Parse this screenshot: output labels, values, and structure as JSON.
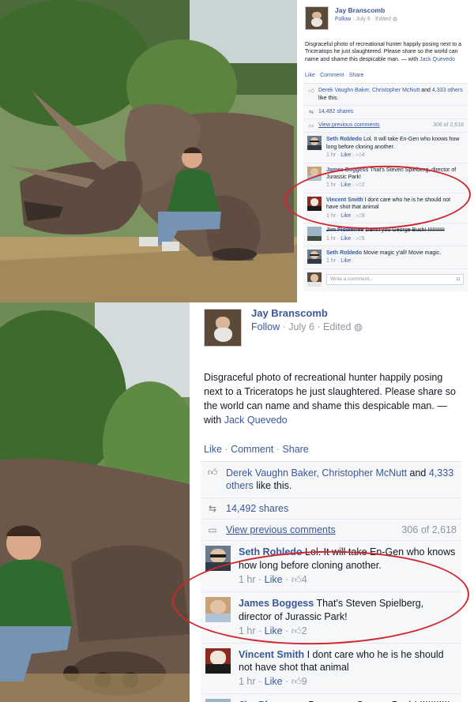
{
  "post": {
    "author": "Jay Branscomb",
    "follow_label": "Follow",
    "date": "July 6",
    "edited_label": "Edited",
    "caption": "Disgraceful photo of recreational hunter happily posing next to a Triceratops he just slaughtered. Please share so the world can name and shame this despicable man.",
    "with_prefix": "— with",
    "tagged": "Jack Quevedo",
    "actions": {
      "like": "Like",
      "comment": "Comment",
      "share": "Share",
      "sep": "·"
    },
    "likes_text": "Derek Vaughn Baker, Christopher McNutt",
    "likes_and": "and",
    "likes_others": "4,333 others",
    "likes_suffix": "like this.",
    "shares": "14,492 shares",
    "view_previous": "View previous comments",
    "comment_count": "306 of 2,618",
    "write_placeholder": "Write a comment..."
  },
  "comments": [
    {
      "name": "Seth Robledo",
      "text": "Lol. It will take En-Gen who knows how long before cloning another.",
      "time": "1 hr",
      "like": "Like",
      "likes": "4"
    },
    {
      "name": "James Boggess",
      "text": "That's Steven Spielberg, director of Jurassic Park!",
      "time": "1 hr",
      "like": "Like",
      "likes": "2"
    },
    {
      "name": "Vincent Smith",
      "text": "I dont care who he is he should not have shot that animal",
      "time": "1 hr",
      "like": "Like",
      "likes": "9"
    },
    {
      "name": "Jim Plowerree",
      "text": "Damn you George Bush! !!!!!!!!!!!",
      "time": "1 hr",
      "like": "Like",
      "likes": "5"
    },
    {
      "name": "Seth Robledo",
      "text": "Movie magic y'all! Movie magic.",
      "time": "1 hr",
      "like": "Like",
      "likes": ""
    }
  ],
  "icons": {
    "like": "thumbs-up-icon",
    "share": "share-icon",
    "comment": "speech-bubble-icon",
    "globe": "globe-icon",
    "camera": "camera-icon"
  },
  "colors": {
    "link": "#3b5998",
    "muted": "#90949c",
    "annotation": "#d0272f"
  }
}
